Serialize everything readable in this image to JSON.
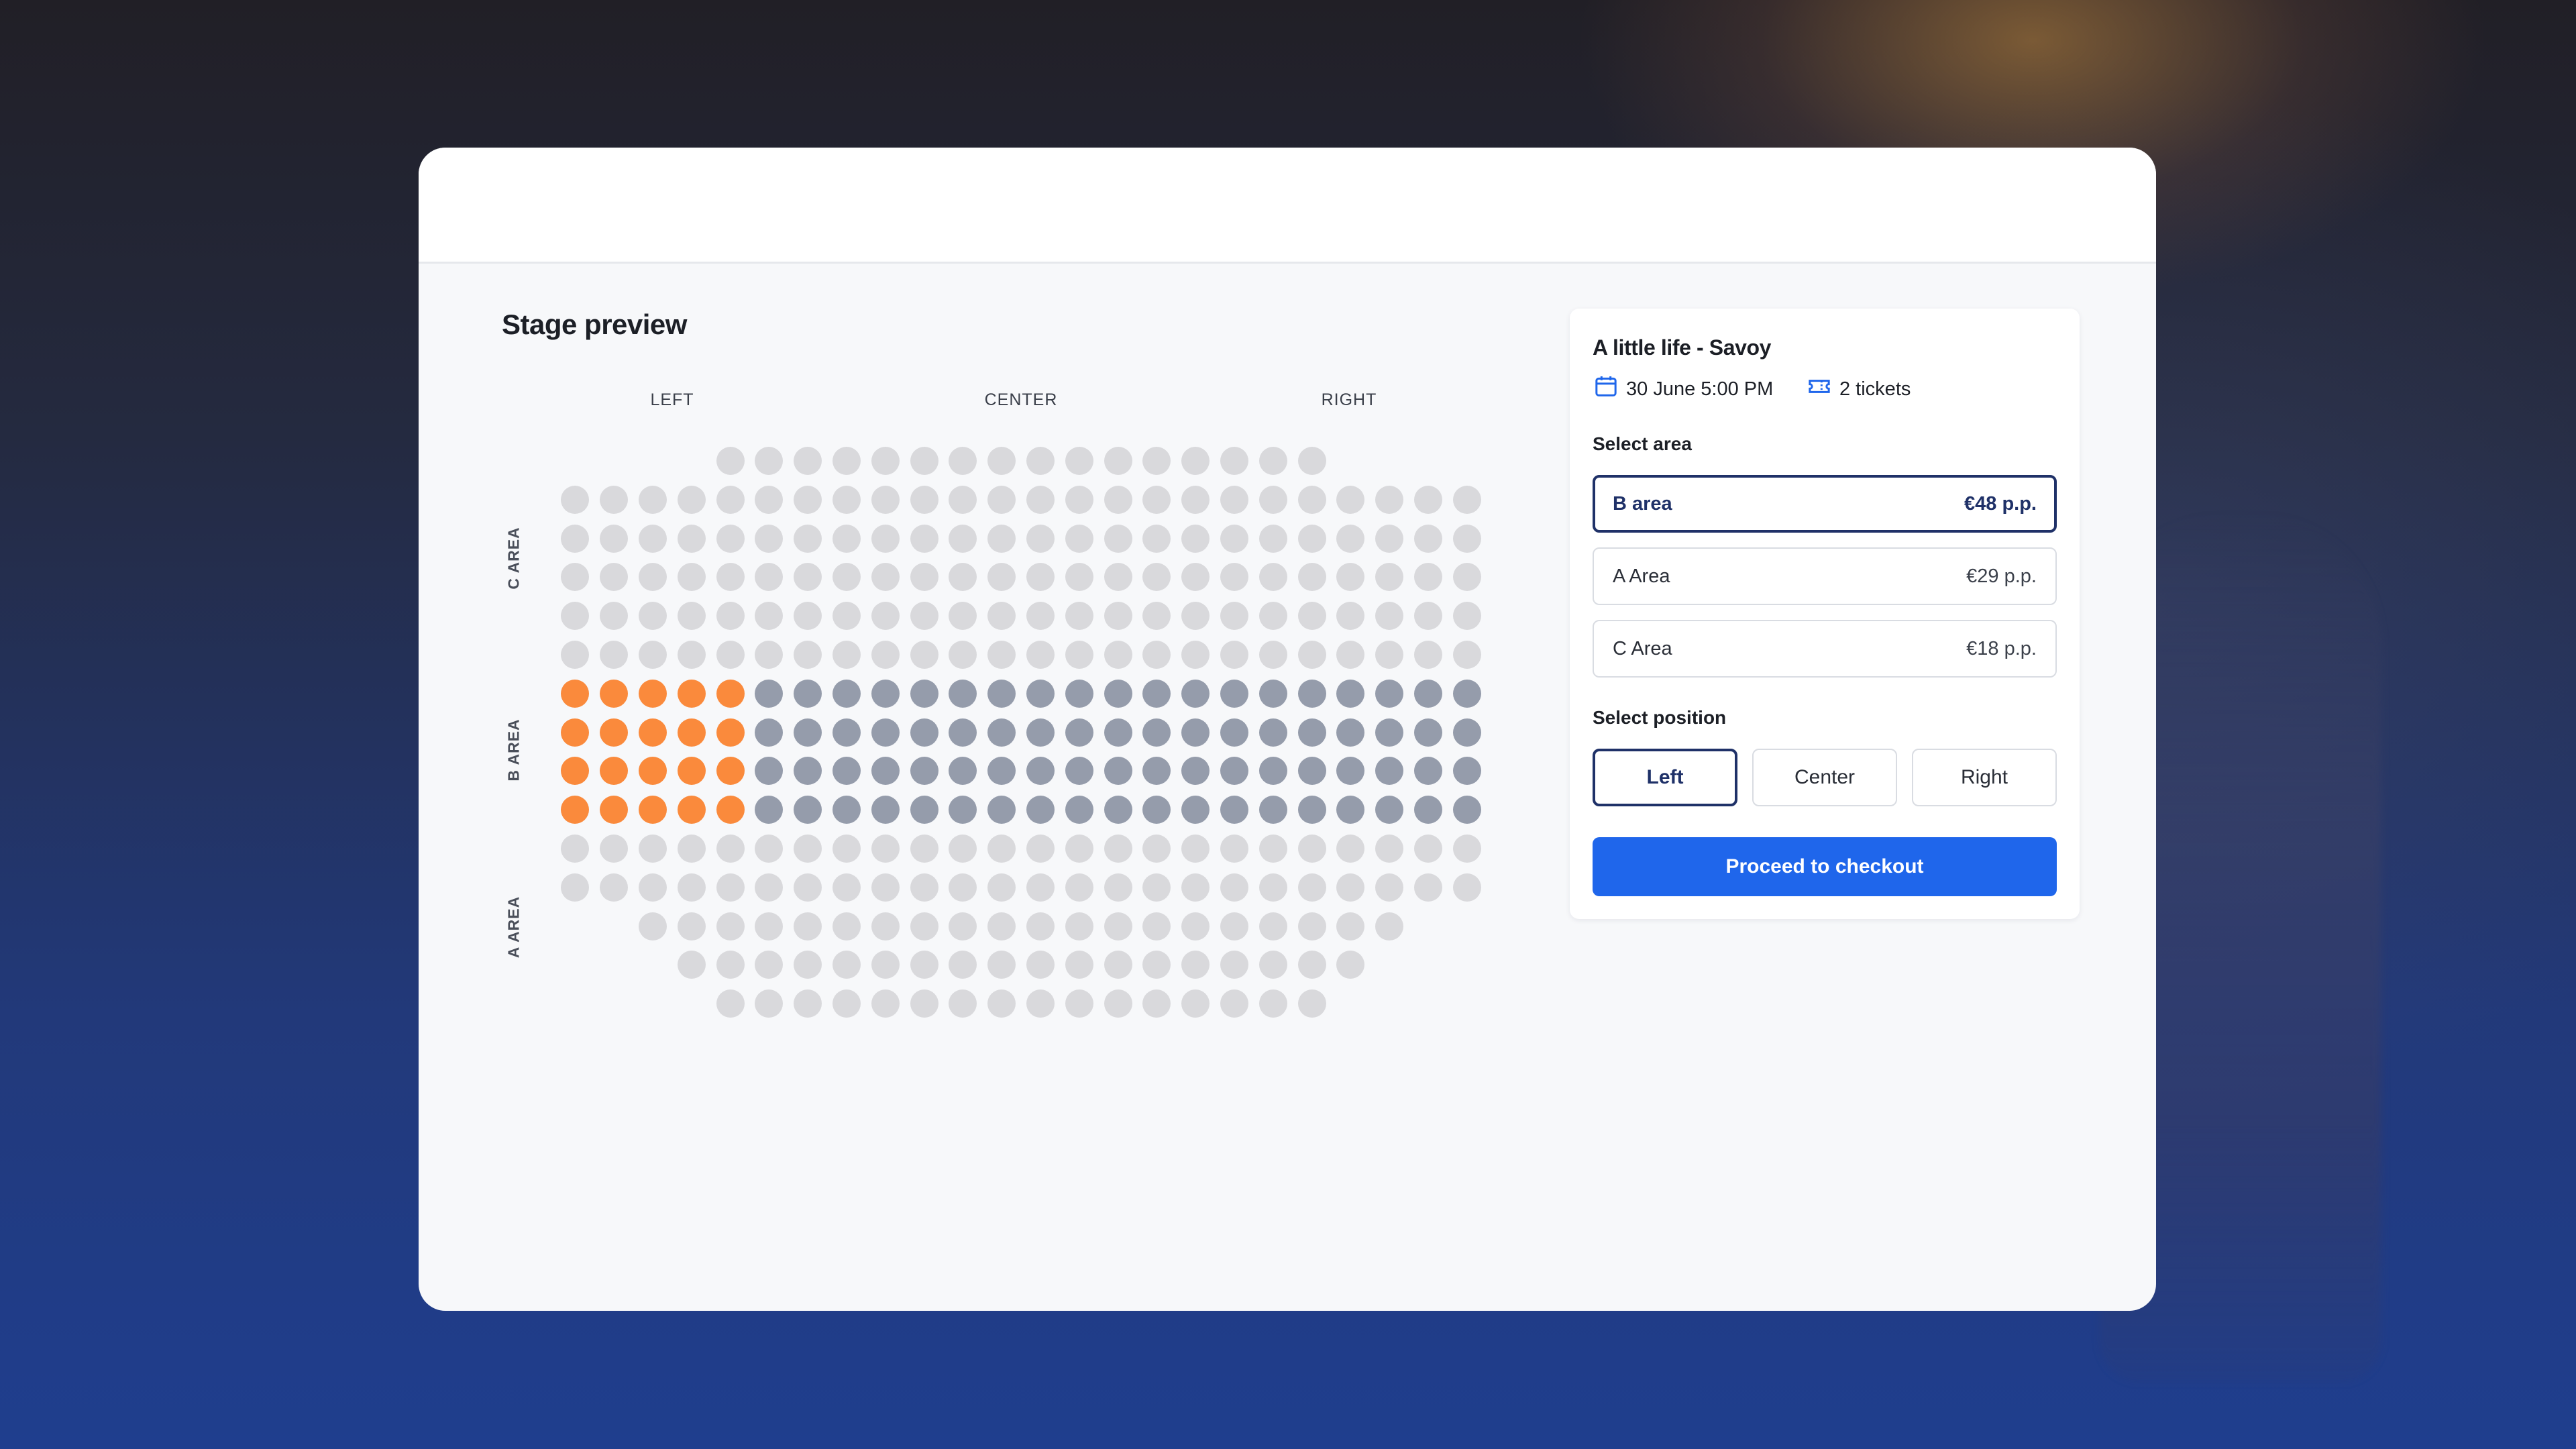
{
  "stage": {
    "title": "Stage preview",
    "columns": [
      "LEFT",
      "CENTER",
      "RIGHT"
    ],
    "areas": [
      "C AREA",
      "B AREA",
      "A AREA"
    ],
    "seat_rows": [
      {
        "seats": 16,
        "status": "available"
      },
      {
        "seats": 24,
        "status": "available"
      },
      {
        "seats": 24,
        "status": "available"
      },
      {
        "seats": 24,
        "status": "available"
      },
      {
        "seats": 24,
        "status": "available"
      },
      {
        "seats": 24,
        "status": "available"
      },
      {
        "seats": 24,
        "status": "b-area",
        "selected": 5
      },
      {
        "seats": 24,
        "status": "b-area",
        "selected": 5
      },
      {
        "seats": 24,
        "status": "b-area",
        "selected": 5
      },
      {
        "seats": 24,
        "status": "b-area",
        "selected": 5
      },
      {
        "seats": 24,
        "status": "available"
      },
      {
        "seats": 24,
        "status": "available"
      },
      {
        "seats": 20,
        "status": "available"
      },
      {
        "seats": 18,
        "status": "available"
      },
      {
        "seats": 16,
        "status": "available"
      }
    ]
  },
  "event": {
    "title": "A little life - Savoy",
    "date": "30 June 5:00 PM",
    "tickets": "2 tickets"
  },
  "select_area": {
    "label": "Select area",
    "options": [
      {
        "name": "B area",
        "price": "€48 p.p."
      },
      {
        "name": "A Area",
        "price": "€29 p.p."
      },
      {
        "name": "C Area",
        "price": "€18 p.p."
      }
    ]
  },
  "select_position": {
    "label": "Select position",
    "options": [
      "Left",
      "Center",
      "Right"
    ]
  },
  "checkout_label": "Proceed to checkout",
  "colors": {
    "accent": "#1f66eb",
    "selected_seat": "#fa8a3c",
    "b_area_seat": "#959cab",
    "available_seat": "#d9d9dc",
    "active_border": "#1f3168"
  }
}
